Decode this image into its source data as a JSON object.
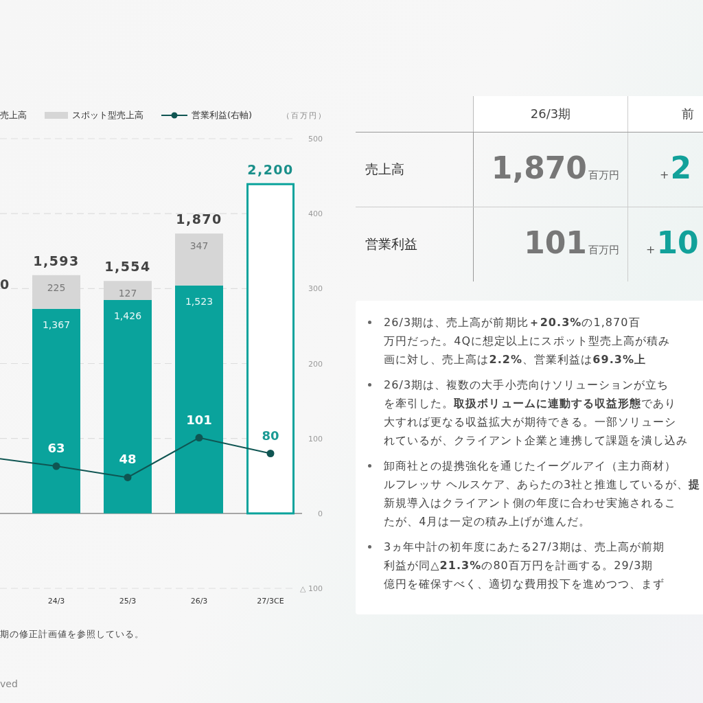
{
  "chart": {
    "clipped_legend": [
      true,
      false
    ],
    "unit": "（百万円）",
    "bars": {
      "forecast": [
        false,
        false,
        false,
        true
      ],
      "chart_data": {
        "type": "bar",
        "stacked": true,
        "grid": true,
        "categories": [
          "24/3",
          "25/3",
          "26/3",
          "27/3CE"
        ],
        "series": [
          {
            "name": "売上高",
            "color": "#0aa39c",
            "values": [
              1367,
              1426,
              1523,
              2200
            ],
            "value_labels": [
              "1,367",
              "1,426",
              "1,523",
              "2,200"
            ]
          },
          {
            "name": "スポット型売上高",
            "color": "#d6d6d6",
            "values": [
              225,
              127,
              347,
              null
            ],
            "value_labels": [
              "225",
              "127",
              "347",
              null
            ]
          }
        ],
        "annotations": [
          "1,593",
          "1,554",
          "1,870"
        ]
      }
    },
    "line": {
      "chart_data": {
        "type": "line",
        "data_labels": true,
        "series": [
          {
            "name": "営業利益(右軸)",
            "color": "#0f5552",
            "marker": "circle",
            "values": [
              63,
              48,
              101,
              80
            ]
          }
        ],
        "ylim": [
          -100,
          500
        ],
        "yticks": [
          500,
          400,
          300,
          200,
          100,
          0,
          {
            "value": -100,
            "label": "△ 100"
          }
        ]
      }
    },
    "clipped_total_label": "0",
    "footnote": "期の修正計画値を参照している。",
    "copyright": "ved"
  },
  "table": {
    "columns": [
      "26/3期",
      "前"
    ],
    "rows": [
      {
        "label": "売上高",
        "value": "1,870",
        "unit": "百万円",
        "sign": "+",
        "change": "2"
      },
      {
        "label": "営業利益",
        "value": "101",
        "unit": "百万円",
        "sign": "+",
        "change": "10"
      }
    ]
  },
  "bullets": [
    [
      "26/3期は、売上高が前期比**＋20.3%**の1,870百",
      "万円だった。4Qに想定以上にスポット型売上高が積み",
      "画に対し、売上高は**2.2%**、営業利益は**69.3%上**"
    ],
    [
      "26/3期は、複数の大手小売向けソリューションが立ち",
      "を牽引した。**取扱ボリュームに連動する収益形態**であり",
      "大すれば更なる収益拡大が期待できる。一部ソリューシ",
      "れているが、クライアント企業と連携して課題を潰し込み"
    ],
    [
      "卸商社との提携強化を通じたイーグルアイ（主力商材）",
      "ルフレッサ ヘルスケア、あらたの3社と推進しているが、**提**",
      "新規導入はクライアント側の年度に合わせ実施されるこ",
      "たが、4月は一定の積み上げが進んだ。"
    ],
    [
      "3ヵ年中計の初年度にあたる27/3期は、売上高が前期",
      "利益が同**△21.3%**の80百万円を計画する。29/3期",
      "億円を確保すべく、適切な費用投下を進めつつ、まず"
    ]
  ]
}
